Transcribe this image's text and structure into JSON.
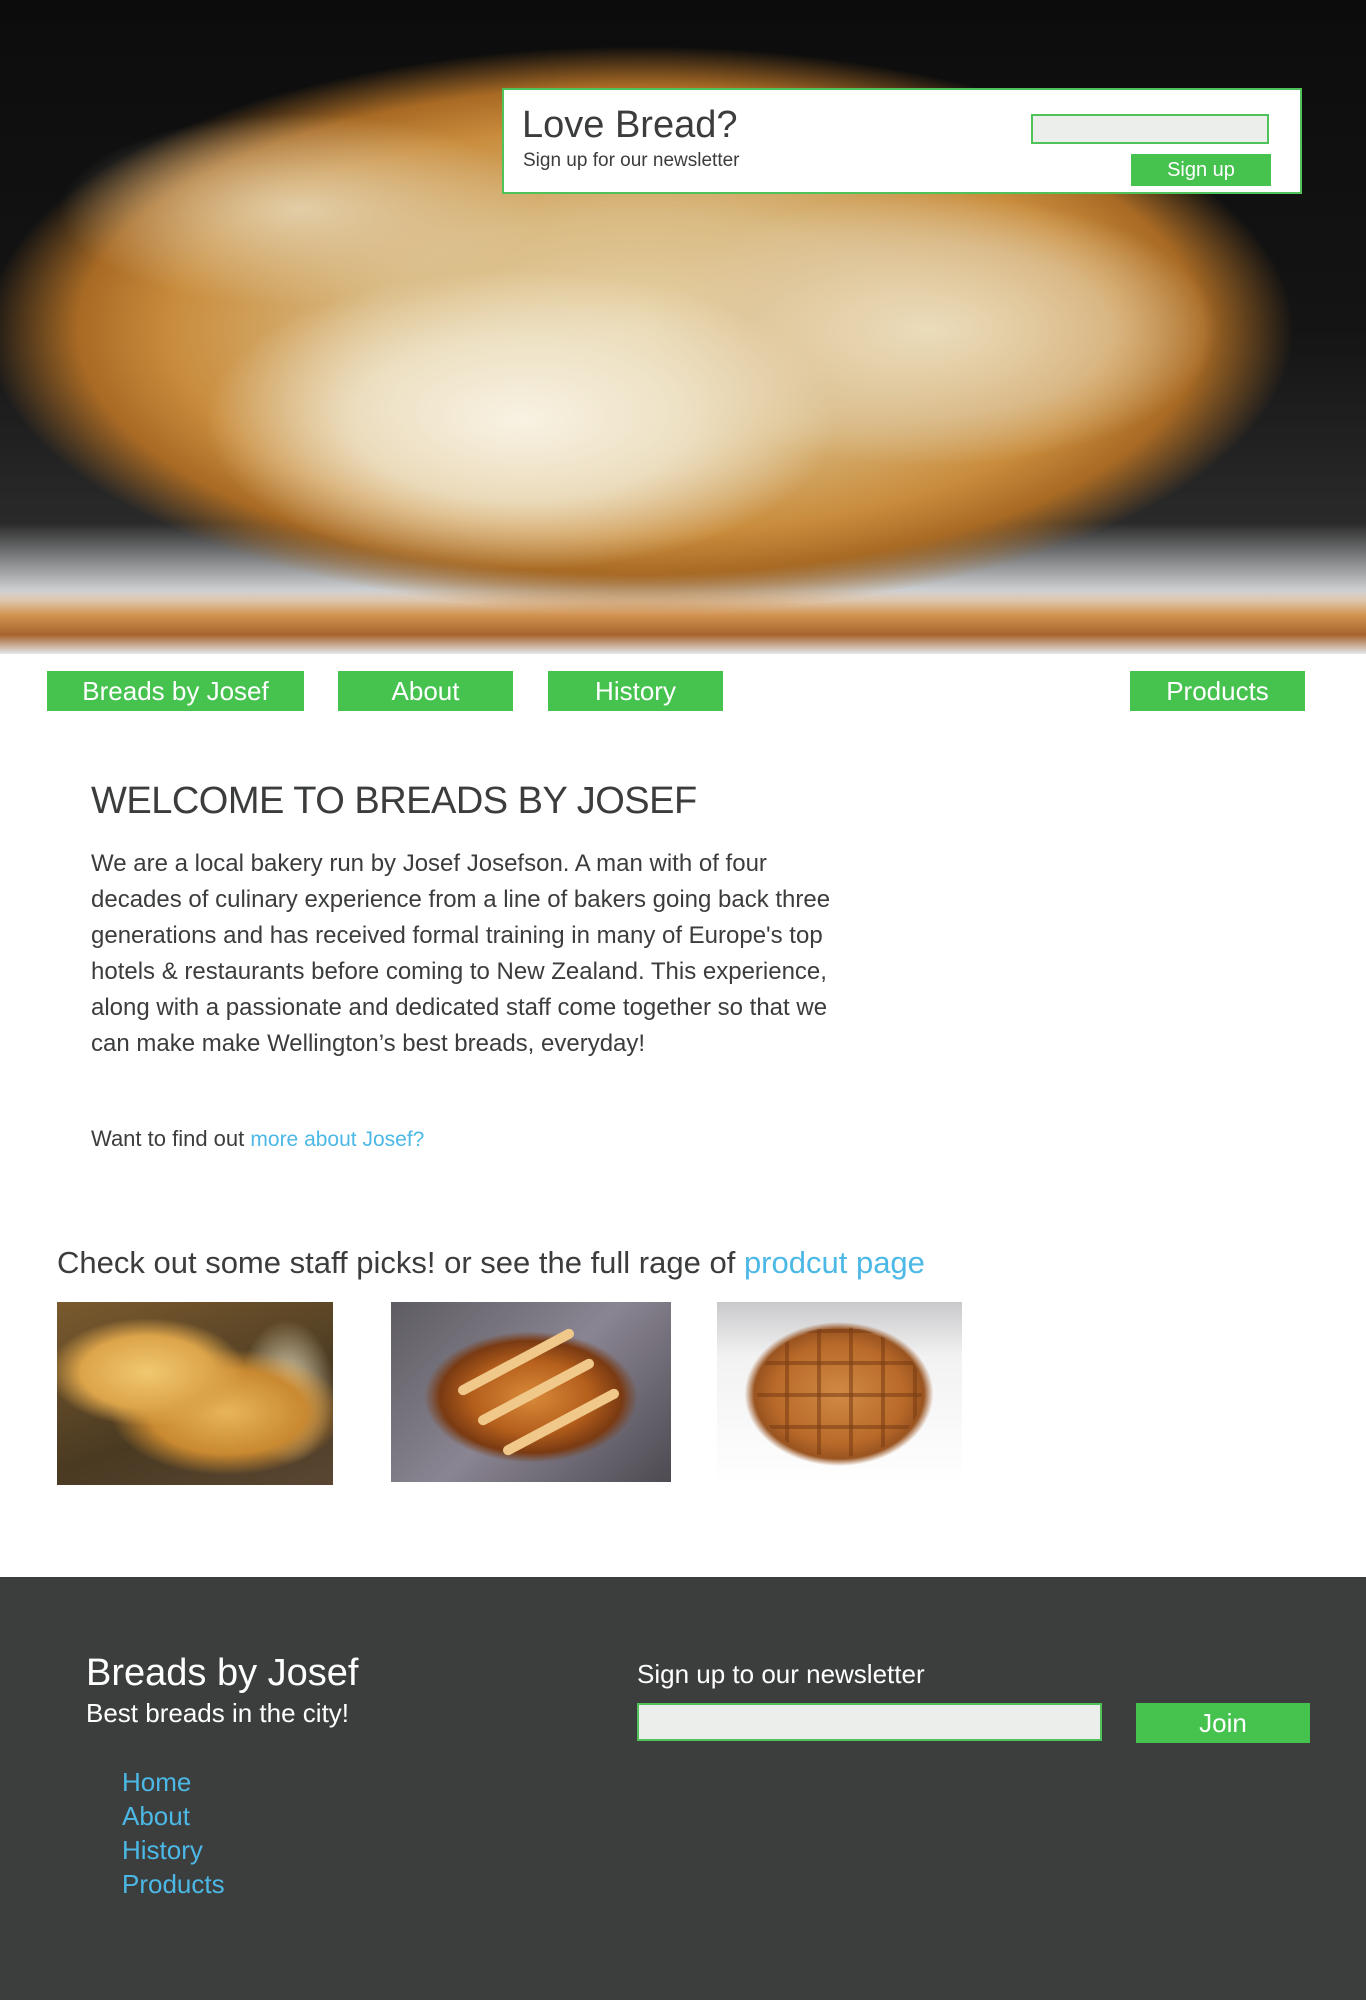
{
  "hero": {
    "signup": {
      "title": "Love Bread?",
      "subtitle": "Sign up for our newsletter",
      "email_value": "",
      "button_label": "Sign up"
    }
  },
  "nav": {
    "items": [
      {
        "label": "Breads by Josef"
      },
      {
        "label": "About"
      },
      {
        "label": "History"
      },
      {
        "label": "Products"
      }
    ]
  },
  "welcome": {
    "title": "WELCOME TO BREADS BY JOSEF",
    "body": "We are a local bakery run by Josef Josefson. A man with of four decades of culinary experience from a line of bakers going back three generations and has received formal training in many of Europe's top hotels & restaurants before coming to New Zealand. This experience, along with a passionate and dedicated staff come together so that we can make make Wellington’s best breads, everyday!",
    "more_prefix": "Want to find out ",
    "more_link": "more about Josef?"
  },
  "picks": {
    "prefix": "Check out some staff picks! or see the full rage of ",
    "link": "prodcut page"
  },
  "footer": {
    "brand": "Breads by Josef",
    "tagline": "Best breads in the city!",
    "links": [
      "Home",
      "About",
      "History",
      "Products"
    ],
    "newsletter_label": "Sign up to our newsletter",
    "email_value": "",
    "join_label": "Join"
  },
  "colors": {
    "accent_green": "#46c24f",
    "link_blue": "#4cb8e6",
    "footer_bg": "#3c3e3d",
    "text_dark": "#3b3d3c"
  }
}
